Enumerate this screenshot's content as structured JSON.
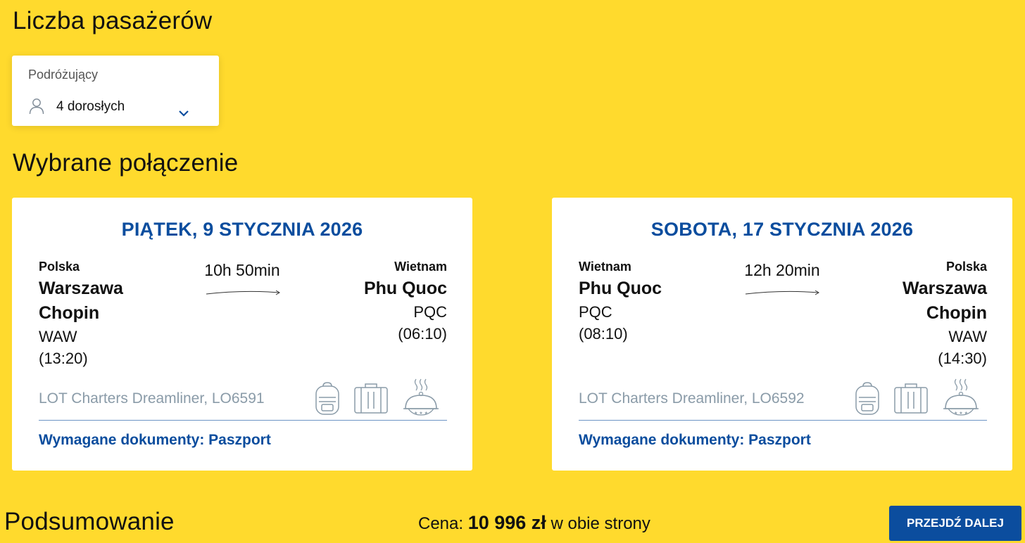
{
  "passengers": {
    "section_title": "Liczba pasażerów",
    "label": "Podróżujący",
    "value": "4 dorosłych",
    "person_icon": "person-icon",
    "chevron_icon": "chevron-down-icon"
  },
  "connection": {
    "section_title": "Wybrane połączenie",
    "outbound": {
      "date": "PIĄTEK, 9 STYCZNIA 2026",
      "from": {
        "country": "Polska",
        "city_line1": "Warszawa",
        "city_line2": "Chopin",
        "code": "WAW",
        "time": "(13:20)"
      },
      "duration": "10h 50min",
      "to": {
        "country": "Wietnam",
        "city_line1": "Phu Quoc",
        "code": "PQC",
        "time": "(06:10)"
      },
      "aircraft": "LOT Charters Dreamliner, LO6591",
      "documents": "Wymagane dokumenty: Paszport"
    },
    "return": {
      "date": "SOBOTA, 17 STYCZNIA 2026",
      "from": {
        "country": "Wietnam",
        "city_line1": "Phu Quoc",
        "code": "PQC",
        "time": "(08:10)"
      },
      "duration": "12h 20min",
      "to": {
        "country": "Polska",
        "city_line1": "Warszawa",
        "city_line2": "Chopin",
        "code": "WAW",
        "time": "(14:30)"
      },
      "aircraft": "LOT Charters Dreamliner, LO6592",
      "documents": "Wymagane dokumenty: Paszport"
    },
    "icons": [
      "backpack-icon",
      "suitcase-icon",
      "meal-icon"
    ]
  },
  "summary": {
    "section_title": "Podsumowanie",
    "price_label": "Cena:",
    "price_amount": "10 996 zł",
    "price_suffix": "w obie strony",
    "next_button": "PRZEJDŹ DALEJ"
  },
  "colors": {
    "background": "#FFDA2D",
    "brand_blue": "#0B4D9E",
    "muted_text": "#8A9BA8"
  }
}
